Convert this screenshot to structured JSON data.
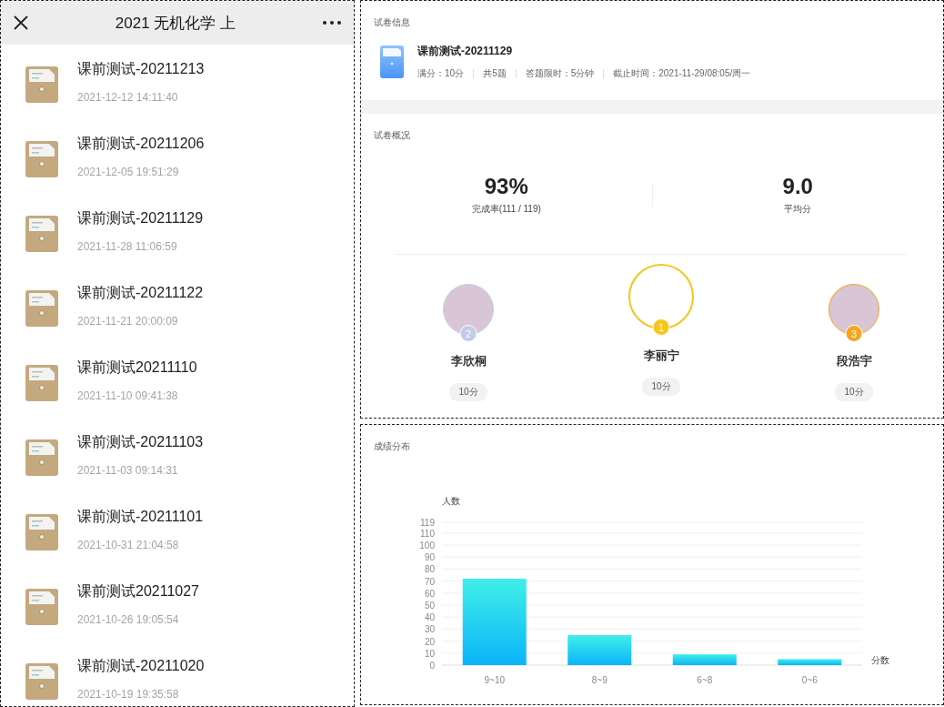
{
  "list_panel": {
    "title": "2021 无机化学 上",
    "items": [
      {
        "title": "课前测试-20211213",
        "date": "2021-12-12 14:11:40"
      },
      {
        "title": "课前测试-20211206",
        "date": "2021-12-05 19:51:29"
      },
      {
        "title": "课前测试-20211129",
        "date": "2021-11-28 11:06:59"
      },
      {
        "title": "课前测试-20211122",
        "date": "2021-11-21 20:00:09"
      },
      {
        "title": "课前测试20211110",
        "date": "2021-11-10 09:41:38"
      },
      {
        "title": "课前测试-20211103",
        "date": "2021-11-03 09:14:31"
      },
      {
        "title": "课前测试-20211101",
        "date": "2021-10-31 21:04:58"
      },
      {
        "title": "课前测试20211027",
        "date": "2021-10-26 19:05:54"
      },
      {
        "title": "课前测试-20211020",
        "date": "2021-10-19 19:35:58"
      }
    ]
  },
  "exam_info": {
    "heading": "试卷信息",
    "title": "课前测试-20211129",
    "meta": [
      "满分：10分",
      "共5题",
      "答题限时：5分钟",
      "截止时间：2021-11-29/08:05/周一"
    ]
  },
  "overview": {
    "heading": "试卷概况",
    "stats": [
      {
        "value": "93%",
        "label": "完成率(111 / 119)"
      },
      {
        "value": "9.0",
        "label": "平均分"
      }
    ],
    "podium": [
      {
        "name": "李欣桐",
        "rank": "2",
        "score": "10分",
        "color": "#c3cbe8",
        "kind": "placer"
      },
      {
        "name": "李丽宁",
        "rank": "1",
        "score": "10分",
        "color": "#f7c51e",
        "kind": "champion"
      },
      {
        "name": "段浩宇",
        "rank": "3",
        "score": "10分",
        "color": "#f6a51f",
        "kind": "placer"
      }
    ]
  },
  "distribution": {
    "heading": "成绩分布",
    "chart_data": {
      "type": "bar",
      "xlabel": "分数",
      "ylabel": "人数",
      "categories": [
        "9~10",
        "8~9",
        "6~8",
        "0~6"
      ],
      "series": [
        {
          "color": "#0ab4f8",
          "values": [
            72,
            25,
            9,
            5
          ]
        }
      ],
      "grid": true,
      "ylim": [
        0,
        119
      ],
      "yticks": [
        0,
        10,
        20,
        30,
        40,
        50,
        60,
        70,
        80,
        90,
        100,
        110,
        119
      ]
    }
  }
}
